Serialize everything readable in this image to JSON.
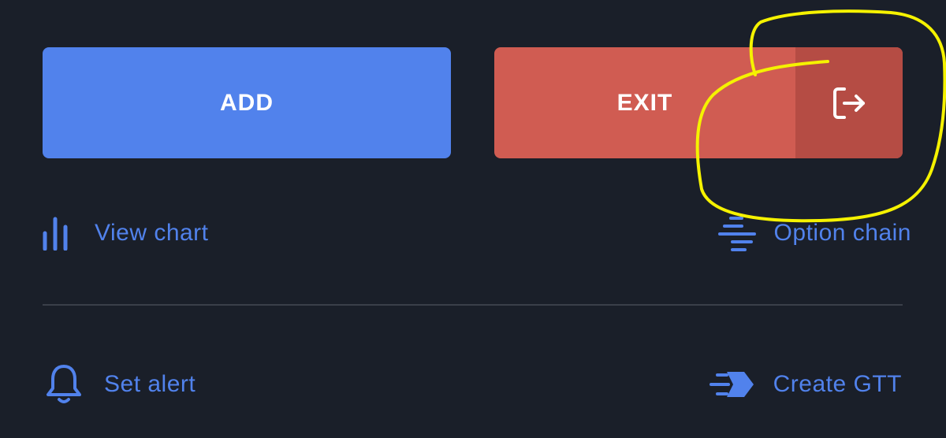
{
  "buttons": {
    "add_label": "ADD",
    "exit_label": "EXIT"
  },
  "actions": {
    "view_chart": "View chart",
    "option_chain": "Option chain",
    "set_alert": "Set alert",
    "create_gtt": "Create GTT"
  },
  "icons": {
    "exit": "exit-arrow-icon",
    "chart": "bar-chart-icon",
    "option_chain": "option-chain-icon",
    "alert": "bell-icon",
    "gtt": "gtt-arrow-icon",
    "annotation": "yellow-circle-annotation"
  },
  "colors": {
    "background": "#1a1f29",
    "add_button": "#5182ec",
    "exit_button": "#d05c52",
    "exit_icon_zone": "#b54c44",
    "link_text": "#5182ec",
    "divider": "#3a3f49",
    "annotation": "#f5f200"
  }
}
